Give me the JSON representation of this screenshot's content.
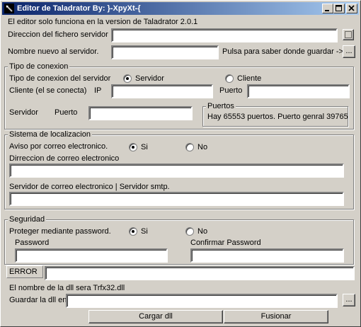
{
  "window": {
    "title": "Editor de Taladrator By: }-XpyXt-{",
    "controls": {
      "minimize": "_",
      "maximize": "□",
      "close": "×"
    }
  },
  "intro": {
    "version_note": "El editor solo funciona en la version de Taladrator 2.0.1"
  },
  "server_path": {
    "label": "Direccion del fichero servidor",
    "value": "",
    "browse_button": "..."
  },
  "new_name": {
    "label": "Nombre nuevo al servidor.",
    "value": "",
    "hint": "Pulsa para saber donde guardar ->",
    "button": "..."
  },
  "connection": {
    "legend": "Tipo de conexion",
    "server_type_label": "Tipo de conexion del servidor",
    "radio_server": "Servidor",
    "radio_client": "Cliente",
    "selected": "Servidor",
    "client_label": "Cliente (el se conecta)",
    "ip_label": "IP",
    "ip_value": "",
    "port_label": "Puerto",
    "port_value": "",
    "server_label": "Servidor",
    "server_port_label": "Puerto",
    "server_port_value": "",
    "ports_legend": "Puertos",
    "ports_info": "Hay 65553 puertos. Puerto genral 39765"
  },
  "location": {
    "legend": "Sistema de localizacion",
    "email_notice_label": "Aviso por correo electronico.",
    "radio_yes": "Si",
    "radio_no": "No",
    "selected": "Si",
    "email_label": "Dirreccion de correo electronico",
    "email_value": "",
    "smtp_label": "Servidor de correo electronico | Servidor smtp.",
    "smtp_value": ""
  },
  "security": {
    "legend": "Seguridad",
    "protect_label": "Proteger mediante password.",
    "radio_yes": "Si",
    "radio_no": "No",
    "selected": "Si",
    "password_label": "Password",
    "password_value": "",
    "confirm_label": "Confirmar Password",
    "confirm_value": ""
  },
  "error": {
    "label": "ERROR",
    "value": ""
  },
  "dll": {
    "name_note": "El nombre de la dll sera Trfx32.dll",
    "save_label": "Guardar la dll en:",
    "save_value": "",
    "browse_button": "...",
    "load_button": "Cargar dll",
    "merge_button": "Fusionar"
  }
}
